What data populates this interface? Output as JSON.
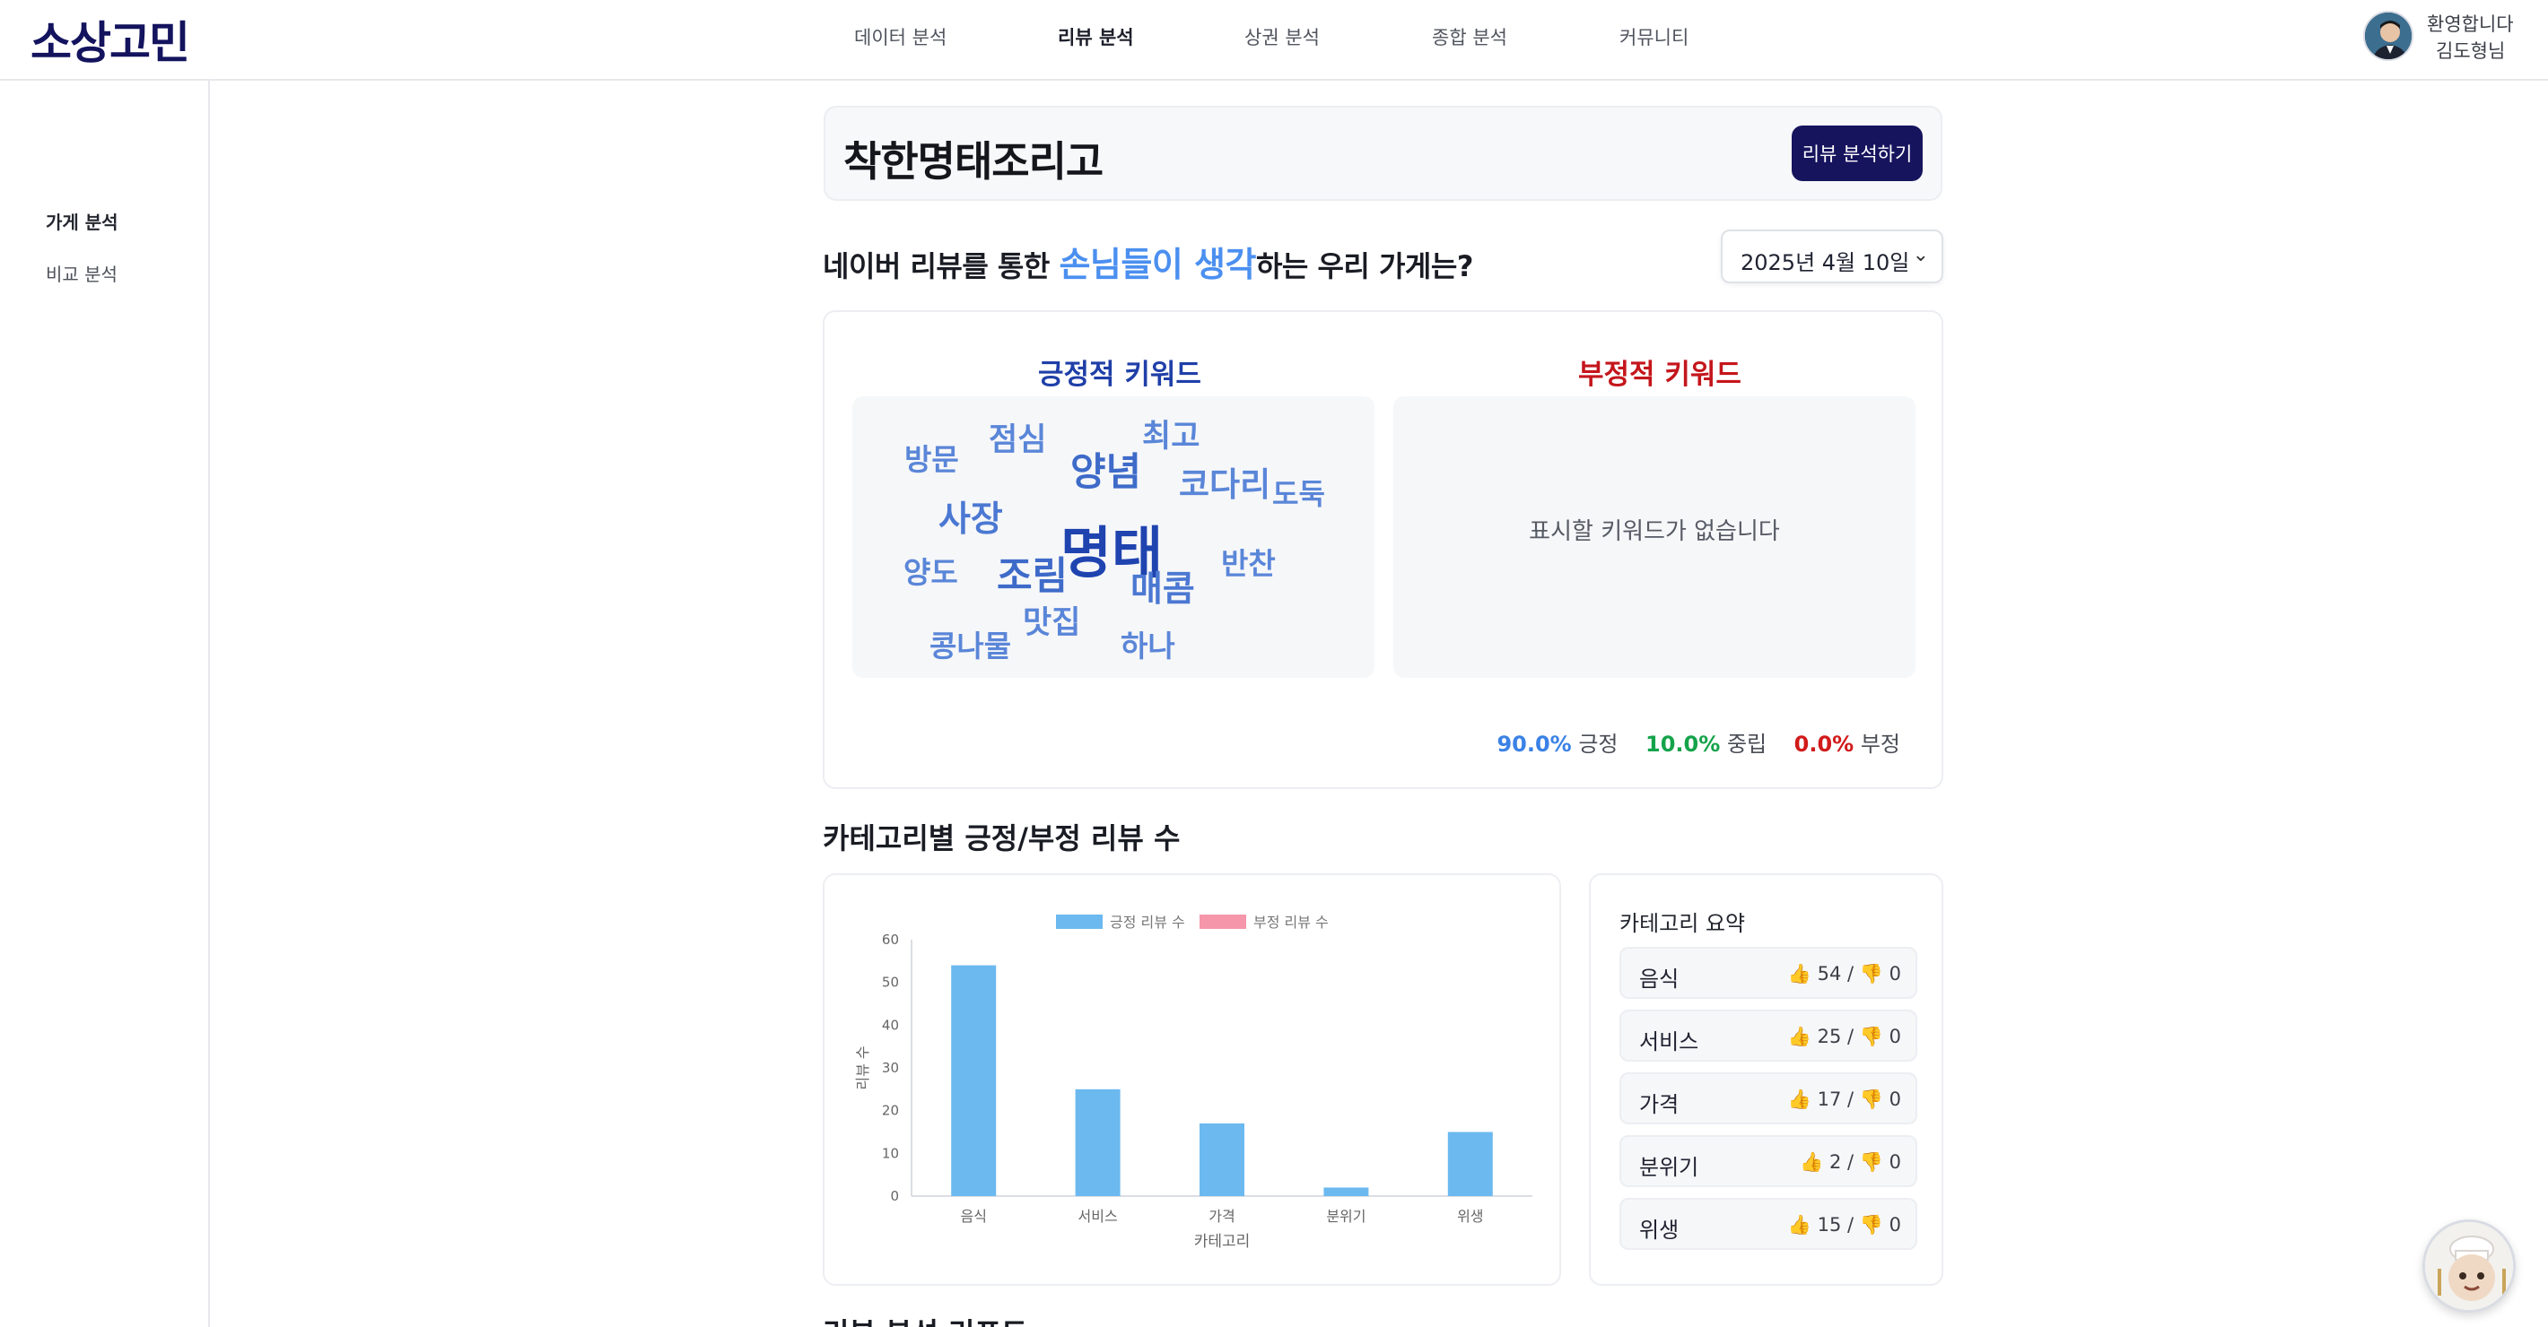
{
  "header": {
    "logo": "소상고민",
    "nav": [
      "데이터 분석",
      "리뷰 분석",
      "상권 분석",
      "종합 분석",
      "커뮤니티"
    ],
    "active_nav": "리뷰 분석",
    "greeting": "환영합니다",
    "user_name": "김도형님"
  },
  "sidebar": {
    "items": [
      "가게 분석",
      "비교 분석"
    ],
    "active": "가게 분석"
  },
  "store": {
    "name": "착한명태조리고",
    "analyze_button": "리뷰 분석하기"
  },
  "question": {
    "prefix": "네이버 리뷰를 통한 ",
    "highlight": "손님들이 생각",
    "suffix": "하는 우리 가게는?"
  },
  "date_select": {
    "value": "2025년 4월 10일"
  },
  "keywords": {
    "positive_title": "긍정적 키워드",
    "negative_title": "부정적 키워드",
    "negative_empty": "표시할 키워드가 없습니다",
    "positive_words": [
      "방문",
      "점심",
      "최고",
      "양념",
      "코다리",
      "도둑",
      "사장",
      "명태",
      "반찬",
      "양도",
      "조림",
      "매콤",
      "맛집",
      "콩나물",
      "하나"
    ]
  },
  "sentiment": {
    "positive_pct": "90.0%",
    "positive_label": "긍정",
    "neutral_pct": "10.0%",
    "neutral_label": "중립",
    "negative_pct": "0.0%",
    "negative_label": "부정"
  },
  "category_heading": "카테고리별 긍정/부정 리뷰 수",
  "chart_data": {
    "type": "bar",
    "categories": [
      "음식",
      "서비스",
      "가격",
      "분위기",
      "위생"
    ],
    "series": [
      {
        "name": "긍정 리뷰 수",
        "values": [
          54,
          25,
          17,
          2,
          15
        ],
        "color": "#6cb9ef"
      },
      {
        "name": "부정 리뷰 수",
        "values": [
          0,
          0,
          0,
          0,
          0
        ],
        "color": "#f596aa"
      }
    ],
    "xlabel": "카테고리",
    "ylabel": "리뷰 수",
    "ylim": [
      0,
      60
    ],
    "yticks": [
      0,
      10,
      20,
      30,
      40,
      50,
      60
    ],
    "legend": "top-center",
    "grid": false
  },
  "summary": {
    "title": "카테고리 요약",
    "rows": [
      {
        "name": "음식",
        "pos": "54",
        "neg": "0"
      },
      {
        "name": "서비스",
        "pos": "25",
        "neg": "0"
      },
      {
        "name": "가격",
        "pos": "17",
        "neg": "0"
      },
      {
        "name": "분위기",
        "pos": "2",
        "neg": "0"
      },
      {
        "name": "위생",
        "pos": "15",
        "neg": "0"
      }
    ]
  },
  "report_heading": "리뷰 분석 리포트"
}
